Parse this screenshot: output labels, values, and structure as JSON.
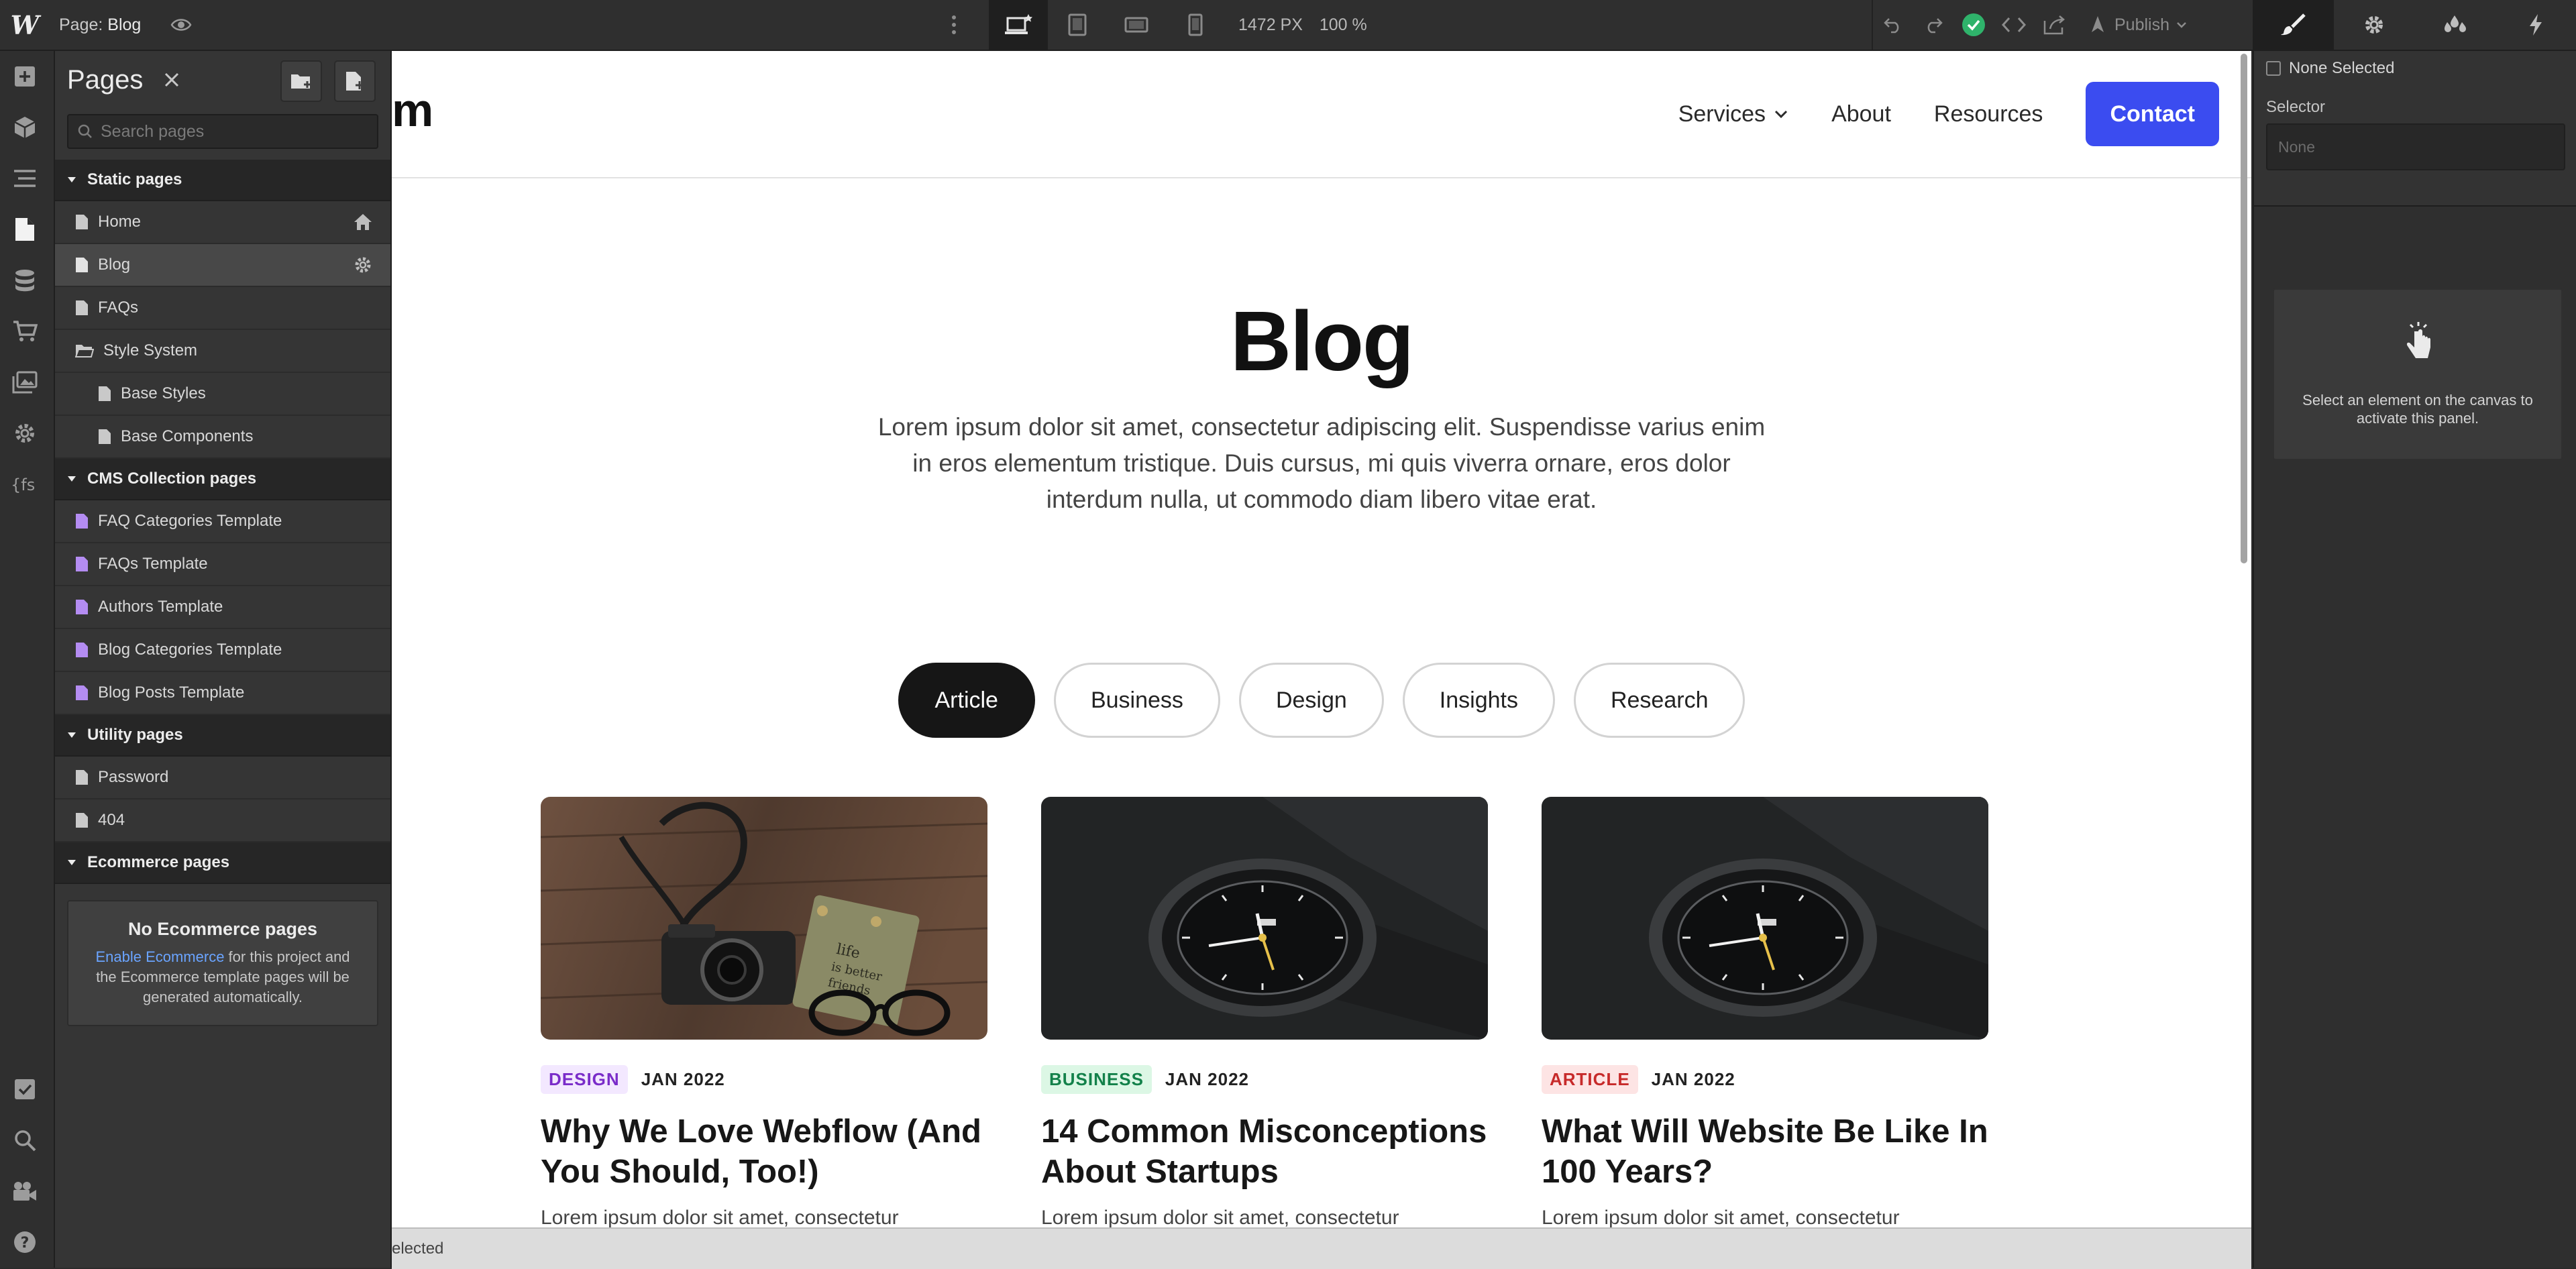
{
  "app": {
    "logo": "W"
  },
  "topbar": {
    "page_prefix": "Page:",
    "page_name": "Blog",
    "canvas_width": "1472 PX",
    "zoom": "100 %",
    "publish_label": "Publish"
  },
  "pages_panel": {
    "title": "Pages",
    "search_placeholder": "Search pages",
    "groups": [
      {
        "label": "Static pages",
        "pages": [
          "Home",
          "Blog",
          "FAQs",
          "Style System",
          "Base Styles",
          "Base Components"
        ]
      },
      {
        "label": "CMS Collection pages",
        "pages": [
          "FAQ Categories Template",
          "FAQs Template",
          "Authors Template",
          "Blog Categories Template",
          "Blog Posts Template"
        ]
      },
      {
        "label": "Utility pages",
        "pages": [
          "Password",
          "404"
        ]
      },
      {
        "label": "Ecommerce pages",
        "pages": []
      }
    ],
    "ecommerce_empty": {
      "title": "No Ecommerce pages",
      "link": "Enable Ecommerce",
      "text": " for this project and the Ecommerce template pages will be generated automatically."
    }
  },
  "site": {
    "logo_fragment": "m",
    "nav": {
      "services": "Services",
      "about": "About",
      "resources": "Resources",
      "contact": "Contact"
    },
    "hero": {
      "title": "Blog",
      "text": "Lorem ipsum dolor sit amet, consectetur adipiscing elit. Suspendisse varius enim in eros elementum tristique. Duis cursus, mi quis viverra ornare, eros dolor interdum nulla, ut commodo diam libero vitae erat."
    },
    "filters": [
      "Article",
      "Business",
      "Design",
      "Insights",
      "Research"
    ],
    "cards": [
      {
        "tag": "DESIGN",
        "date": "JAN 2022",
        "title": "Why We Love Webflow (And You Should, Too!)",
        "excerpt": "Lorem ipsum dolor sit amet, consectetur"
      },
      {
        "tag": "BUSINESS",
        "date": "JAN 2022",
        "title": "14 Common Misconceptions About Startups",
        "excerpt": "Lorem ipsum dolor sit amet, consectetur"
      },
      {
        "tag": "ARTICLE",
        "date": "JAN 2022",
        "title": "What Will Website Be Like In 100 Years?",
        "excerpt": "Lorem ipsum dolor sit amet, consectetur"
      }
    ]
  },
  "statusbar": {
    "text": "elected"
  },
  "style_panel": {
    "none_selected": "None Selected",
    "selector_label": "Selector",
    "selector_placeholder": "None",
    "empty_text": "Select an element on the canvas to activate this panel."
  },
  "colors": {
    "accent": "#3b4cf0",
    "editor_bg": "#2b2b2b",
    "panel_bg": "#353535",
    "success": "#2fb36b"
  }
}
